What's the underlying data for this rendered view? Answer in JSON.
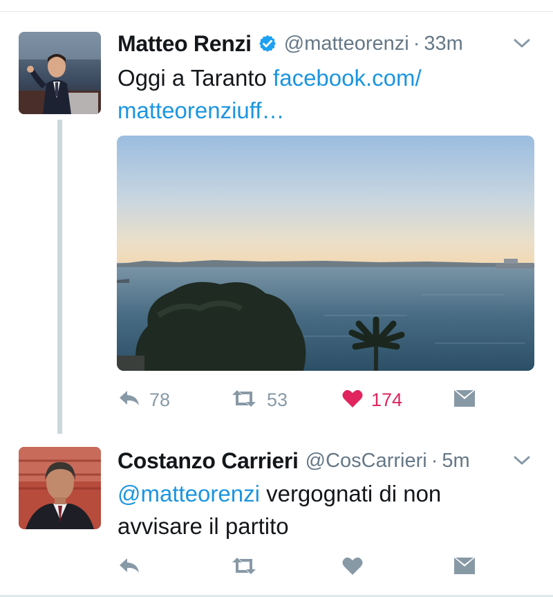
{
  "tweets": [
    {
      "author_name": "Matteo Renzi",
      "verified": true,
      "handle": "@matteorenzi",
      "separator": "·",
      "time": "33m",
      "text_plain": "Oggi a Taranto ",
      "link_line1": "facebook.com/",
      "link_line2": "matteorenziuff…",
      "has_media": true,
      "actions": {
        "replies": "78",
        "retweets": "53",
        "likes": "174",
        "liked": true
      }
    },
    {
      "author_name": "Costanzo Carrieri",
      "verified": false,
      "handle": "@CosCarrieri",
      "separator": "·",
      "time": "5m",
      "mention": "@matteorenzi",
      "text_after_mention": " vergognati di non avvisare il partito",
      "has_media": false,
      "actions": {
        "replies": "",
        "retweets": "",
        "likes": "",
        "liked": false
      }
    }
  ],
  "colors": {
    "link": "#1b95e0",
    "muted": "#657786",
    "icon": "#8899a6",
    "like_active": "#e0245e",
    "verified": "#1da1f2",
    "thread_line": "#ccd6dd"
  },
  "icons": {
    "reply": "reply-icon",
    "retweet": "retweet-icon",
    "like": "heart-icon",
    "dm": "envelope-icon",
    "menu": "chevron-down-icon",
    "verified": "verified-badge-icon"
  }
}
